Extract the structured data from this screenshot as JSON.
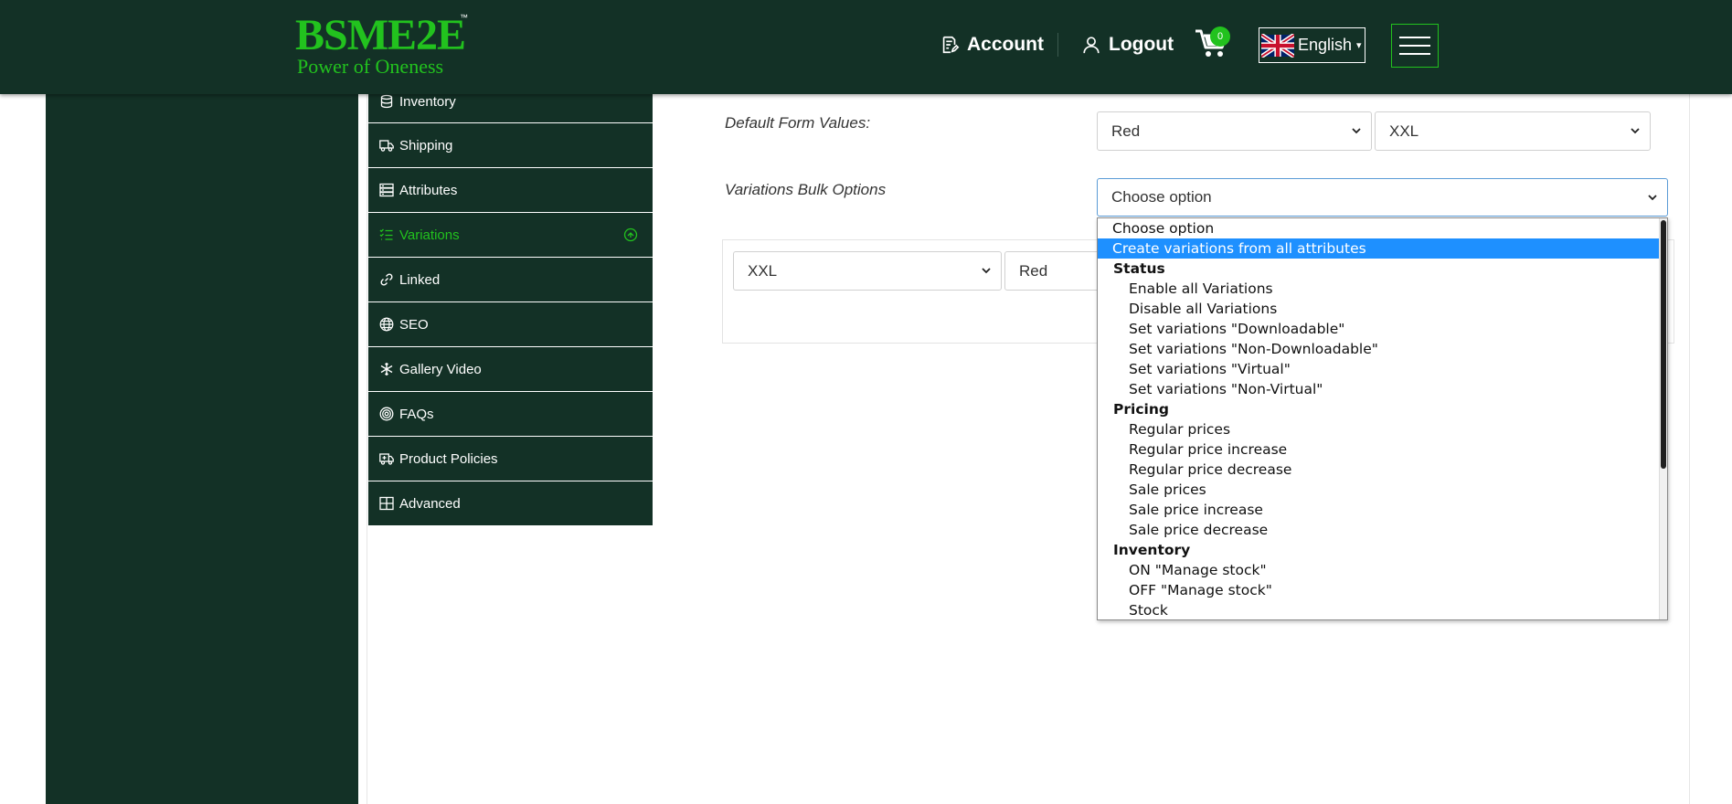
{
  "brand": {
    "name": "BSME2E",
    "trademark": "™",
    "tagline": "Power of Oneness"
  },
  "header": {
    "account_label": "Account",
    "logout_label": "Logout",
    "cart_count": "0",
    "language": "English",
    "language_caret": "▾"
  },
  "tabs": [
    {
      "label": "Inventory",
      "icon": "database-icon"
    },
    {
      "label": "Shipping",
      "icon": "truck-icon"
    },
    {
      "label": "Attributes",
      "icon": "server-icon"
    },
    {
      "label": "Variations",
      "icon": "list-check-icon",
      "active": true
    },
    {
      "label": "Linked",
      "icon": "link-icon"
    },
    {
      "label": "SEO",
      "icon": "globe-icon"
    },
    {
      "label": "Gallery Video",
      "icon": "snowflake-icon"
    },
    {
      "label": "FAQs",
      "icon": "target-icon"
    },
    {
      "label": "Product Policies",
      "icon": "ambulance-icon"
    },
    {
      "label": "Advanced",
      "icon": "table-icon"
    }
  ],
  "form": {
    "default_values_label": "Default Form Values:",
    "default_color": "Red",
    "default_size": "XXL",
    "bulk_label": "Variations Bulk Options",
    "bulk_selected": "Choose option"
  },
  "variation_row": {
    "size": "XXL",
    "color": "Red"
  },
  "dropdown": {
    "items": [
      {
        "label": "Choose option",
        "kind": "option"
      },
      {
        "label": "Create variations from all attributes",
        "kind": "option",
        "selected": true
      },
      {
        "label": "Status",
        "kind": "group"
      },
      {
        "label": "Enable all Variations",
        "kind": "sub"
      },
      {
        "label": "Disable all Variations",
        "kind": "sub"
      },
      {
        "label": "Set variations \"Downloadable\"",
        "kind": "sub"
      },
      {
        "label": "Set variations \"Non-Downloadable\"",
        "kind": "sub"
      },
      {
        "label": "Set variations \"Virtual\"",
        "kind": "sub"
      },
      {
        "label": "Set variations \"Non-Virtual\"",
        "kind": "sub"
      },
      {
        "label": "Pricing",
        "kind": "group"
      },
      {
        "label": "Regular prices",
        "kind": "sub"
      },
      {
        "label": "Regular price increase",
        "kind": "sub"
      },
      {
        "label": "Regular price decrease",
        "kind": "sub"
      },
      {
        "label": "Sale prices",
        "kind": "sub"
      },
      {
        "label": "Sale price increase",
        "kind": "sub"
      },
      {
        "label": "Sale price decrease",
        "kind": "sub"
      },
      {
        "label": "Inventory",
        "kind": "group"
      },
      {
        "label": "ON \"Manage stock\"",
        "kind": "sub"
      },
      {
        "label": "OFF \"Manage stock\"",
        "kind": "sub"
      },
      {
        "label": "Stock",
        "kind": "sub"
      }
    ]
  },
  "colors": {
    "dark_green": "#133126",
    "brand_green": "#22c21e",
    "highlight_blue": "#1e90ff"
  }
}
